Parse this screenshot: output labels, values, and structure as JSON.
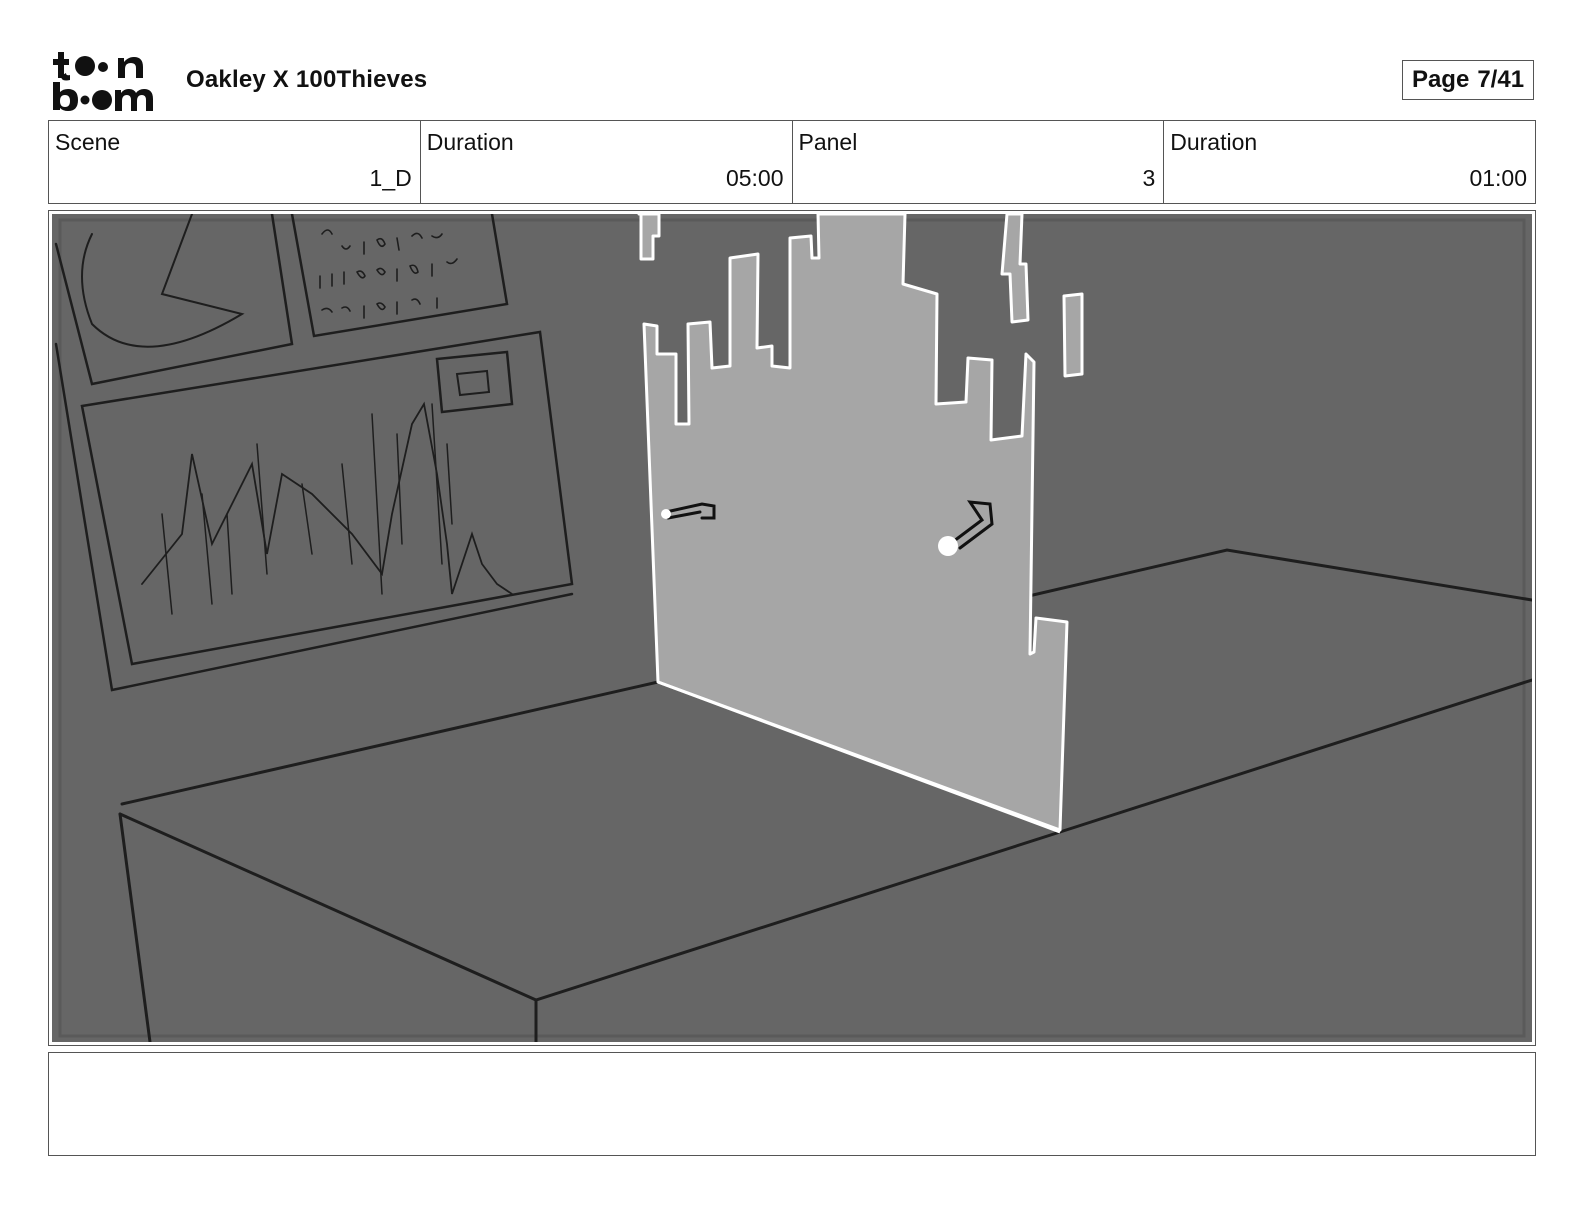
{
  "header": {
    "logo_text": "toon boom",
    "project_title": "Oakley X 100Thieves",
    "page_label": "Page",
    "page_number": "7/41"
  },
  "info": {
    "scene_label": "Scene",
    "scene_value": "1_D",
    "scene_duration_label": "Duration",
    "scene_duration_value": "05:00",
    "panel_label": "Panel",
    "panel_value": "3",
    "panel_duration_label": "Duration",
    "panel_duration_value": "01:00"
  },
  "colors": {
    "panel_background": "#666666",
    "sketch_line": "#1e1e1e",
    "hologram_fill": "#a6a6a6",
    "hologram_stroke": "#ffffff"
  },
  "notes": {
    "text": ""
  }
}
